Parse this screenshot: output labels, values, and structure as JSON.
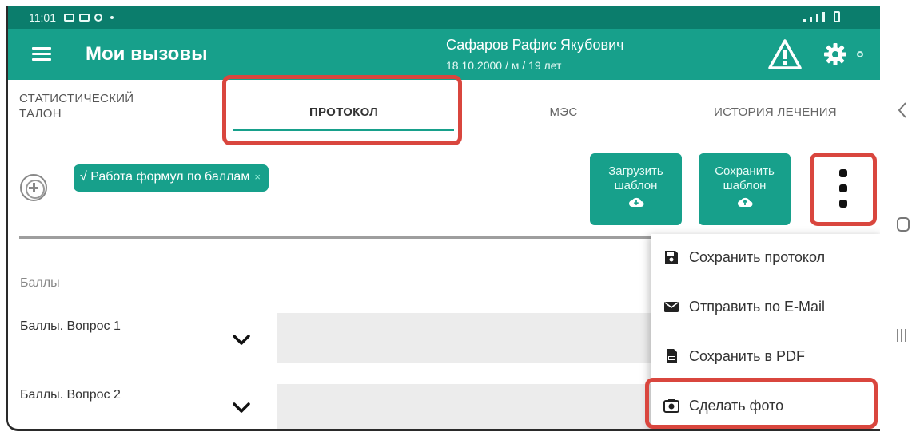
{
  "status_bar": {
    "time": "11:01"
  },
  "app_bar": {
    "title": "Мои вызовы",
    "patient_name": "Сафаров Рафис Якубович",
    "patient_info": "18.10.2000 / м / 19 лет"
  },
  "tabs": [
    {
      "label_line1": "СТАТИСТИЧЕСКИЙ",
      "label_line2": "ТАЛОН"
    },
    {
      "label": "ПРОТОКОЛ",
      "selected": true
    },
    {
      "label": "МЭС"
    },
    {
      "label": "ИСТОРИЯ ЛЕЧЕНИЯ"
    }
  ],
  "toolbar": {
    "chip_label": "√ Работа формул по баллам",
    "chip_close": "×",
    "load_template_line1": "Загрузить",
    "load_template_line2": "шаблон",
    "save_template_line1": "Сохранить",
    "save_template_line2": "шаблон"
  },
  "form": {
    "section_label": "Баллы",
    "questions": [
      {
        "label": "Баллы. Вопрос 1"
      },
      {
        "label": "Баллы. Вопрос 2"
      }
    ]
  },
  "menu": {
    "items": [
      {
        "label": "Сохранить протокол",
        "icon": "floppy-disk-icon"
      },
      {
        "label": "Отправить по E-Mail",
        "icon": "envelope-icon"
      },
      {
        "label": "Сохранить в PDF",
        "icon": "pdf-file-icon"
      },
      {
        "label": "Сделать фото",
        "icon": "camera-icon"
      }
    ]
  },
  "colors": {
    "status_bar": "#0b7d6c",
    "app_bar": "#17a08b",
    "accent": "#17a08b",
    "highlight": "#d9463e"
  }
}
